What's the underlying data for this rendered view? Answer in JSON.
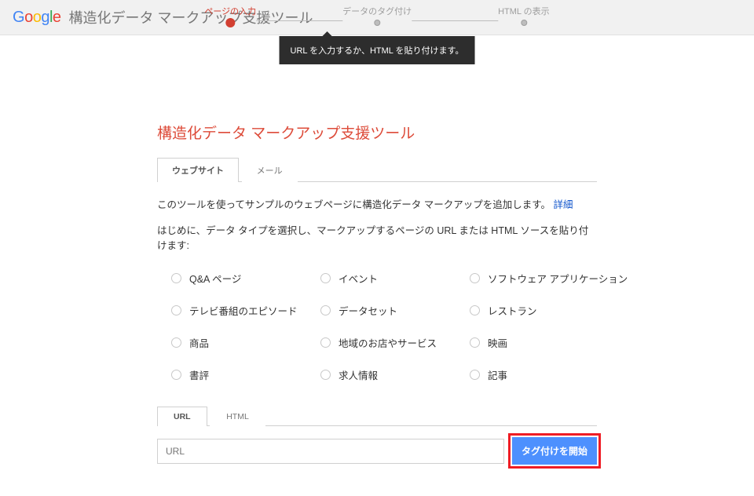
{
  "logo_letters": [
    "G",
    "o",
    "o",
    "g",
    "l",
    "e"
  ],
  "app_title": "構造化データ マークアップ支援ツール",
  "stepper": {
    "steps": [
      "ページの入力",
      "データのタグ付け",
      "HTML の表示"
    ],
    "active_index": 0
  },
  "tooltip": "URL を入力するか、HTML を貼り付けます。",
  "main": {
    "title": "構造化データ マークアップ支援ツール",
    "tabs": [
      "ウェブサイト",
      "メール"
    ],
    "active_tab": 0,
    "intro_text": "このツールを使ってサンプルのウェブページに構造化データ マークアップを追加します。 ",
    "intro_link": "詳細",
    "subintro": "はじめに、データ タイプを選択し、マークアップするページの URL または HTML ソースを貼り付けます:",
    "radio_options": [
      "Q&A ページ",
      "イベント",
      "ソフトウェア アプリケーション",
      "テレビ番組のエピソード",
      "データセット",
      "レストラン",
      "商品",
      "地域のお店やサービス",
      "映画",
      "書評",
      "求人情報",
      "記事"
    ],
    "input_tabs": [
      "URL",
      "HTML"
    ],
    "input_active_tab": 0,
    "url_placeholder": "URL",
    "start_button": "タグ付けを開始"
  }
}
